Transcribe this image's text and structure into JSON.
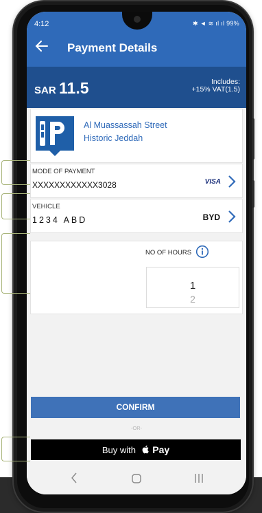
{
  "status": {
    "time": "4:12",
    "icons": "✱ ◄ ≋ ıl ıl 99%"
  },
  "header": {
    "title": "Payment Details",
    "back_icon": "arrow-left-icon"
  },
  "price": {
    "currency": "SAR",
    "amount": "11.5",
    "includes_line1": "Includes:",
    "includes_line2": "+15% VAT(1.5)"
  },
  "location": {
    "icon": "parking-icon",
    "line1": "Al Muassassah Street",
    "line2": "Historic Jeddah"
  },
  "payment": {
    "label": "MODE OF PAYMENT",
    "card_number": "XXXXXXXXXXXX3028",
    "brand": "VISA"
  },
  "vehicle": {
    "label": "VEHICLE",
    "plate": "1234 ABD",
    "make": "BYD"
  },
  "hours": {
    "label": "NO OF HOURS",
    "selected": "1",
    "next": "2"
  },
  "actions": {
    "confirm_label": "CONFIRM",
    "or_label": "-OR-",
    "applepay_prefix": "Buy with",
    "applepay_word": "Pay"
  },
  "colors": {
    "primary": "#2f6ab9",
    "price_bar": "#1f4f8e",
    "confirm": "#3f72b8"
  }
}
